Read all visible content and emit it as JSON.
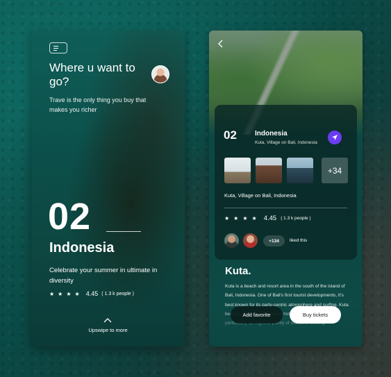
{
  "left": {
    "menu_icon": "menu-icon",
    "heading": "Where u want to go?",
    "subtitle": "Trave is the only thing you buy that makes you richer",
    "number": "02",
    "country": "Indonesia",
    "description": "Celebrate your summer in ultimate in diversity",
    "rating": "4.45",
    "people": "( 1.3 k people )",
    "stars": 4,
    "upswipe": "Upswipe to more"
  },
  "right": {
    "number": "02",
    "country": "Indonesia",
    "location": "Kuta, Village on Bali, Indonesia",
    "more_photos": "+34",
    "location2": "Kuta, Village on Bali, Indonesia",
    "rating": "4.45",
    "people": "( 1.3 k people )",
    "stars": 4,
    "likes": "+134",
    "liked_text": "liked this",
    "title": "Kuta.",
    "body": "Kuta is a beach and resort area in the south of the island of Bali, Indonesia. One of Bali's first tourist developments, it's best known for its party-centric atmosphere and surfing. Kuta beach's main strip lined with hotels, restaurants, and particularly for nightlife plenty of outfitters offering",
    "fav_button": "Add favorite",
    "buy_button": "Buy tickets"
  },
  "colors": {
    "accent": "#6a3cf2",
    "teal": "#0c4f4a"
  }
}
